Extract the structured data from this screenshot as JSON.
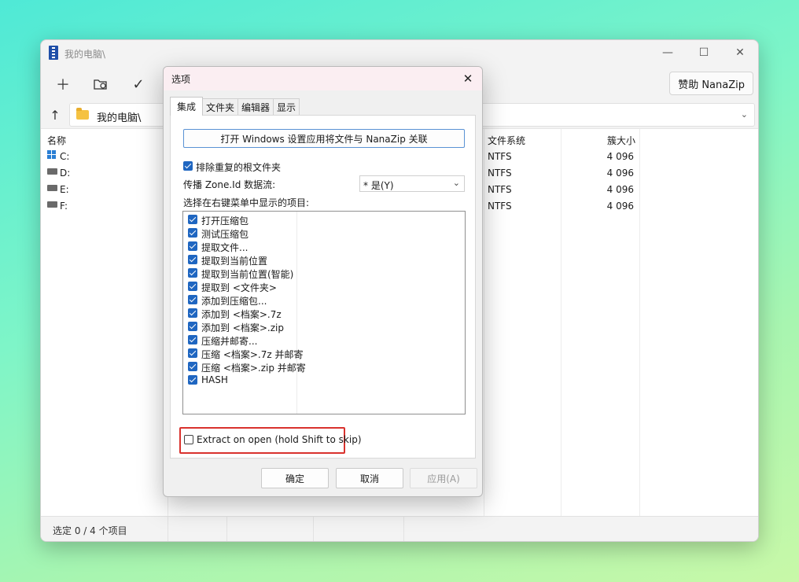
{
  "main_window": {
    "title": "我的电脑\\",
    "toolbar": {
      "add_icon": "plus-icon",
      "extract_icon": "folder-extract-icon",
      "test_icon": "check-icon",
      "sponsor_label": "赞助 NanaZip"
    },
    "address": {
      "up_icon": "arrow-up-icon",
      "path": "我的电脑\\"
    },
    "columns": {
      "name": "名称",
      "filesystem": "文件系统",
      "cluster_size": "簇大小"
    },
    "drives": [
      {
        "name": "C:",
        "filesystem": "NTFS",
        "cluster_size": "4 096",
        "icon": "windows-drive-icon"
      },
      {
        "name": "D:",
        "filesystem": "NTFS",
        "cluster_size": "4 096",
        "icon": "drive-icon"
      },
      {
        "name": "E:",
        "filesystem": "NTFS",
        "cluster_size": "4 096",
        "icon": "drive-icon"
      },
      {
        "name": "F:",
        "filesystem": "NTFS",
        "cluster_size": "4 096",
        "icon": "drive-icon"
      }
    ],
    "status": "选定 0 / 4 个项目"
  },
  "dialog": {
    "title": "选项",
    "tabs": [
      "集成",
      "文件夹",
      "编辑器",
      "显示"
    ],
    "active_tab": "集成",
    "associate_button": "打开 Windows 设置应用将文件与 NanaZip 关联",
    "eliminate_dup_root": {
      "label": "排除重复的根文件夹",
      "checked": true
    },
    "zone_id_label": "传播 Zone.Id 数据流:",
    "zone_id_value": "* 是(Y)",
    "context_menu_label": "选择在右键菜单中显示的项目:",
    "context_items": [
      {
        "label": "打开压缩包",
        "checked": true
      },
      {
        "label": "测试压缩包",
        "checked": true
      },
      {
        "label": "提取文件...",
        "checked": true
      },
      {
        "label": "提取到当前位置",
        "checked": true
      },
      {
        "label": "提取到当前位置(智能)",
        "checked": true
      },
      {
        "label": "提取到 <文件夹>",
        "checked": true
      },
      {
        "label": "添加到压缩包...",
        "checked": true
      },
      {
        "label": "添加到 <档案>.7z",
        "checked": true
      },
      {
        "label": "添加到 <档案>.zip",
        "checked": true
      },
      {
        "label": "压缩并邮寄...",
        "checked": true
      },
      {
        "label": "压缩 <档案>.7z 并邮寄",
        "checked": true
      },
      {
        "label": "压缩 <档案>.zip 并邮寄",
        "checked": true
      },
      {
        "label": "HASH",
        "checked": true
      }
    ],
    "extract_on_open": {
      "label": "Extract on open (hold Shift to skip)",
      "checked": false
    },
    "highlight_color": "#d9322e",
    "buttons": {
      "ok": "确定",
      "cancel": "取消",
      "apply": "应用(A)"
    }
  }
}
